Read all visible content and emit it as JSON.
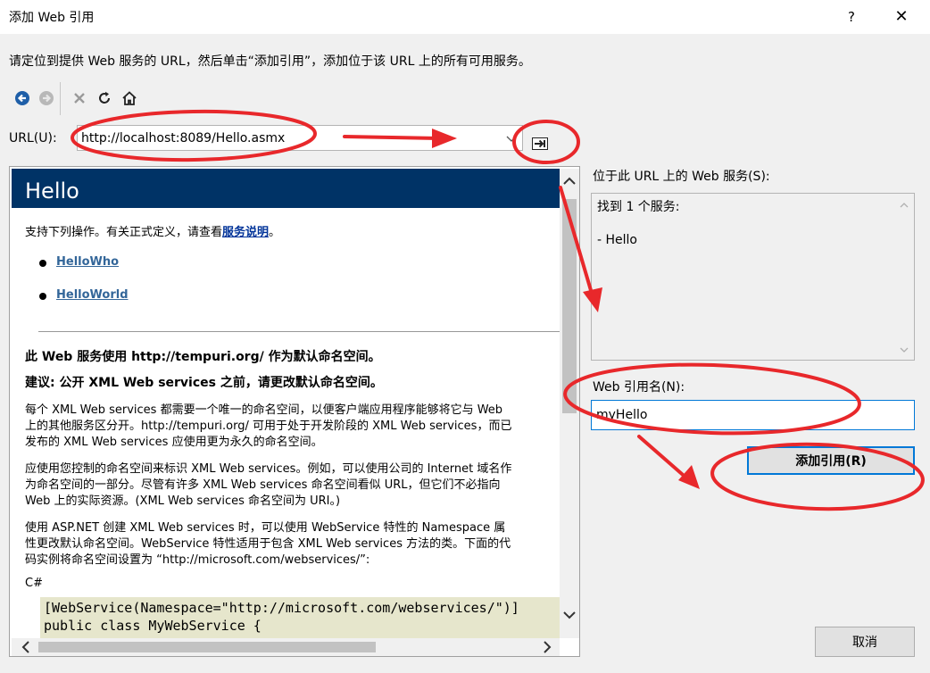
{
  "window": {
    "title": "添加 Web 引用",
    "help": "?",
    "close": "✕"
  },
  "instruction": "请定位到提供 Web 服务的 URL，然后单击“添加引用”，添加位于该 URL 上的所有可用服务。",
  "toolbar": {
    "icons": [
      "back-icon",
      "forward-icon",
      "stop-icon",
      "refresh-icon",
      "home-icon"
    ]
  },
  "url": {
    "label": "URL(U):",
    "value": "http://localhost:8089/Hello.asmx"
  },
  "browser": {
    "title": "Hello",
    "intro_prefix": "支持下列操作。有关正式定义，请查看",
    "intro_link": "服务说明",
    "intro_suffix": "。",
    "operations": [
      "HelloWho",
      "HelloWorld"
    ],
    "ns_line1": "此  Web 服务使用  http://tempuri.org/ 作为默认命名空间。",
    "ns_line2": "建议: 公开  XML Web services 之前，请更改默认命名空间。",
    "para1": [
      "每个  XML Web services 都需要一个唯一的命名空间，以便客户端应用程序能够将它与  Web",
      "上的其他服务区分开。http://tempuri.org/ 可用于处于开发阶段的  XML Web services，而已",
      "发布的  XML Web services 应使用更为永久的命名空间。"
    ],
    "para2": [
      "应使用您控制的命名空间来标识  XML Web services。例如，可以使用公司的  Internet 域名作",
      "为命名空间的一部分。尽管有许多  XML Web services 命名空间看似  URL，但它们不必指向",
      "Web 上的实际资源。(XML Web services 命名空间为  URI。)"
    ],
    "para3": [
      "使用  ASP.NET 创建  XML Web services 时，可以使用  WebService 特性的  Namespace 属",
      "性更改默认命名空间。WebService 特性适用于包含  XML Web services 方法的类。下面的代",
      "码实例将命名空间设置为 “http://microsoft.com/webservices/”:"
    ],
    "lang": "C#",
    "code": [
      "[WebService(Namespace=\"http://microsoft.com/webservices/\")]",
      "public class MyWebService {"
    ]
  },
  "services": {
    "label": "位于此 URL 上的 Web 服务(S):",
    "found": "找到 1 个服务:",
    "item": "- Hello"
  },
  "reference": {
    "label": "Web 引用名(N):",
    "value": "myHello"
  },
  "buttons": {
    "add": "添加引用(R)",
    "cancel": "取消"
  },
  "colors": {
    "annotation": "#e8282b",
    "header_bg": "#003366",
    "focus_border": "#0078d7"
  }
}
